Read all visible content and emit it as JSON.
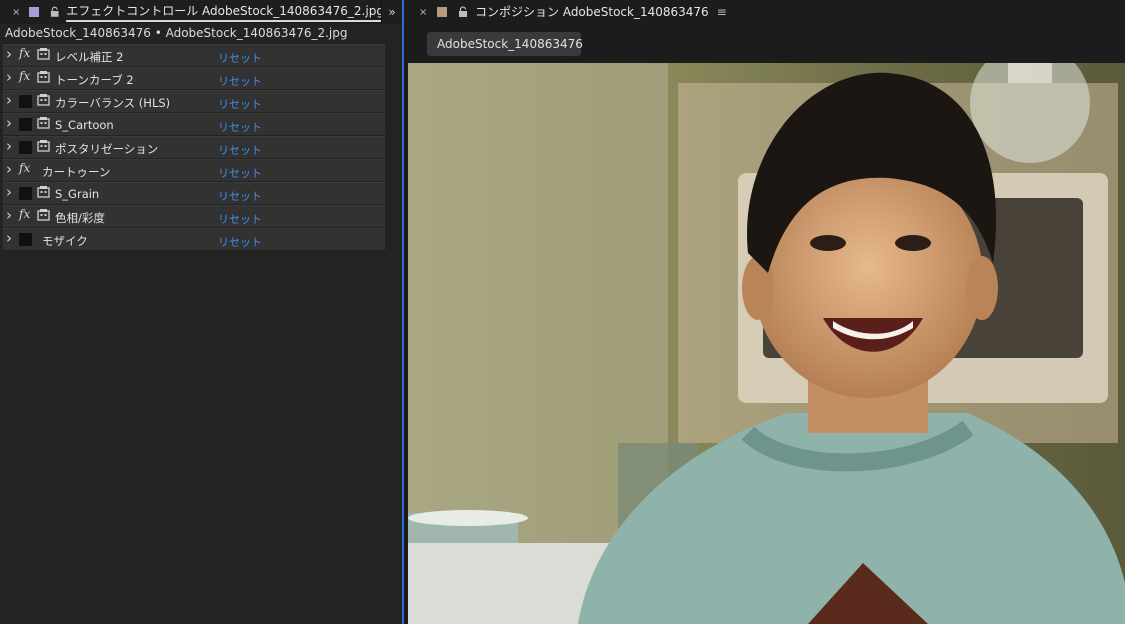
{
  "left_panel": {
    "tab_close": "×",
    "tab_title": "エフェクトコントロール AdobeStock_140863476_2.jpg",
    "tab_menu": "≡",
    "panel_expand": "»",
    "subtitle": "AdobeStock_140863476 • AdobeStock_140863476_2.jpg",
    "effects": [
      {
        "name": "レベル補正 2",
        "fx": true,
        "icon": true,
        "reset": "リセット"
      },
      {
        "name": "トーンカーブ 2",
        "fx": true,
        "icon": true,
        "reset": "リセット"
      },
      {
        "name": "カラーバランス (HLS)",
        "fx": false,
        "icon": true,
        "reset": "リセット"
      },
      {
        "name": "S_Cartoon",
        "fx": false,
        "icon": true,
        "reset": "リセット"
      },
      {
        "name": "ポスタリゼーション",
        "fx": false,
        "icon": true,
        "reset": "リセット"
      },
      {
        "name": "カートゥーン",
        "fx": true,
        "icon": false,
        "reset": "リセット"
      },
      {
        "name": "S_Grain",
        "fx": false,
        "icon": true,
        "reset": "リセット"
      },
      {
        "name": "色相/彩度",
        "fx": true,
        "icon": true,
        "reset": "リセット"
      },
      {
        "name": "モザイク",
        "fx": false,
        "icon": false,
        "reset": "リセット"
      }
    ]
  },
  "right_panel": {
    "tab_close": "×",
    "tab_title": "コンポジション AdobeStock_140863476",
    "tab_menu": "≡",
    "comp_chip": "AdobeStock_140863476"
  },
  "colors": {
    "accent_blue": "#2d6fd0",
    "reset_link": "#3e8ee8",
    "left_swatch": "#a99fd8",
    "right_swatch": "#b59a7c"
  }
}
